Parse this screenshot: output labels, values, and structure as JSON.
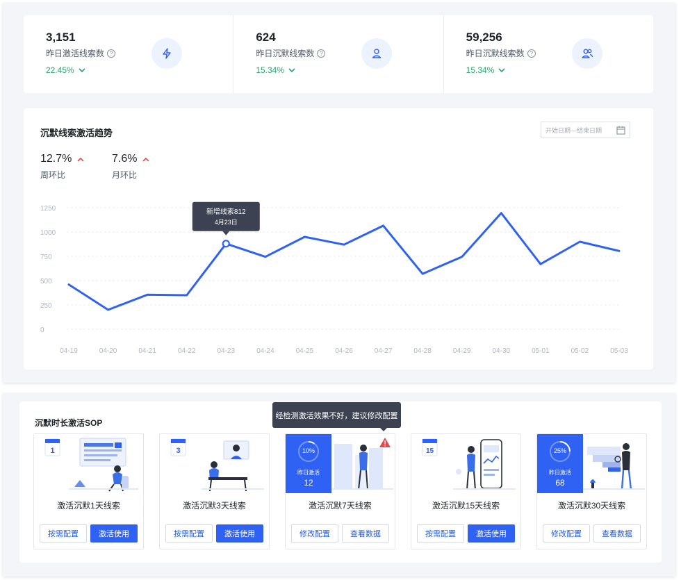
{
  "stats": [
    {
      "value": "3,151",
      "label": "昨日激活线索数",
      "change": "22.45%",
      "icon": "bolt-icon"
    },
    {
      "value": "624",
      "label": "昨日沉默线索数",
      "change": "15.34%",
      "icon": "user-icon"
    },
    {
      "value": "59,256",
      "label": "昨日沉默线索数",
      "change": "15.34%",
      "icon": "users-icon"
    }
  ],
  "trend": {
    "title": "沉默线索激活趋势",
    "date_placeholder": "开始日期—结束日期",
    "kpis": [
      {
        "value": "12.7%",
        "label": "周环比",
        "direction": "up"
      },
      {
        "value": "7.6%",
        "label": "月环比",
        "direction": "up"
      }
    ]
  },
  "chart_data": {
    "type": "line",
    "x": [
      "04-19",
      "04-20",
      "04-21",
      "04-22",
      "04-23",
      "04-24",
      "04-25",
      "04-26",
      "04-27",
      "04-28",
      "04-29",
      "04-30",
      "05-01",
      "05-02",
      "05-03"
    ],
    "series": [
      {
        "values": [
          460,
          200,
          355,
          350,
          880,
          745,
          950,
          870,
          1065,
          570,
          745,
          1195,
          670,
          900,
          805
        ]
      }
    ],
    "yticks": [
      0,
      250,
      500,
      750,
      1000,
      1250
    ],
    "ylim": [
      0,
      1250
    ],
    "grid": true,
    "line_color": "#2f61f2",
    "tooltip": {
      "index": 4,
      "line1": "新增线索812",
      "line2": "4月23日"
    }
  },
  "sop": {
    "title": "沉默时长激活SOP",
    "tooltip": "经检测激活效果不好，建议修改配置",
    "items": [
      {
        "name": "激活沉默1天线索",
        "badge": "1",
        "buttons": [
          "按需配置",
          "激活使用"
        ]
      },
      {
        "name": "激活沉默3天线索",
        "badge": "3",
        "buttons": [
          "按需配置",
          "激活使用"
        ]
      },
      {
        "name": "激活沉默7天线索",
        "percent": "10%",
        "percent_value": 0.1,
        "stat_label": "昨日激活",
        "stat_value": "12",
        "buttons": [
          "修改配置",
          "查看数据"
        ]
      },
      {
        "name": "激活沉默15天线索",
        "badge": "15",
        "buttons": [
          "按需配置",
          "激活使用"
        ]
      },
      {
        "name": "激活沉默30天线索",
        "percent": "25%",
        "percent_value": 0.25,
        "stat_label": "昨日激活",
        "stat_value": "68",
        "buttons": [
          "修改配置",
          "查看数据"
        ]
      }
    ]
  }
}
